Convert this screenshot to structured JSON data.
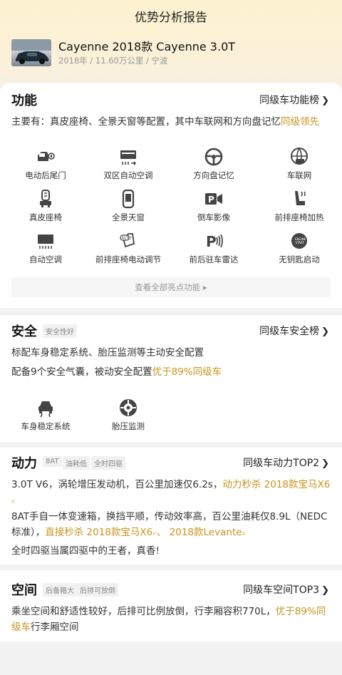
{
  "page_title": "优势分析报告",
  "car": {
    "title": "Cayenne 2018款 Cayenne 3.0T",
    "meta": "2018年 / 11.60万公里 / 宁波"
  },
  "features": {
    "title": "功能",
    "link": "同级车功能榜",
    "summary_prefix": "主要有：真皮座椅、全景天窗等配置，其中车联网和方向盘记忆",
    "summary_highlight": "同级领先",
    "items": [
      {
        "label": "电动后尾门",
        "icon": "power-tailgate-icon"
      },
      {
        "label": "双区自动空调",
        "icon": "dual-zone-ac-icon"
      },
      {
        "label": "方向盘记忆",
        "icon": "steering-wheel-icon"
      },
      {
        "label": "车联网",
        "icon": "globe-car-icon"
      },
      {
        "label": "真皮座椅",
        "icon": "leather-seat-icon"
      },
      {
        "label": "全景天窗",
        "icon": "sunroof-icon"
      },
      {
        "label": "倒车影像",
        "icon": "reverse-camera-icon"
      },
      {
        "label": "前排座椅加热",
        "icon": "seat-heating-icon"
      },
      {
        "label": "自动空调",
        "icon": "auto-ac-icon"
      },
      {
        "label": "前排座椅电动调节",
        "icon": "power-seat-icon"
      },
      {
        "label": "前后驻车雷达",
        "icon": "parking-radar-icon"
      },
      {
        "label": "无钥匙启动",
        "icon": "keyless-start-icon"
      }
    ],
    "view_all": "查看全部亮点功能 ▸"
  },
  "safety": {
    "title": "安全",
    "tag": "安全性好",
    "link": "同级车安全榜",
    "line1": "标配车身稳定系统、胎压监测等主动安全配置",
    "line2_prefix": "配备9个安全气囊，被动安全配置",
    "line2_highlight": "优于89%同级车",
    "items": [
      {
        "label": "车身稳定系统",
        "icon": "stability-icon"
      },
      {
        "label": "胎压监测",
        "icon": "tire-pressure-icon"
      }
    ]
  },
  "power": {
    "title": "动力",
    "tags": [
      "8AT",
      "油耗低",
      "全时四驱"
    ],
    "link": "同级车动力TOP2",
    "p1_prefix": "3.0T V6，涡轮增压发动机，百公里加速仅6.2s，",
    "p1_highlight": "动力秒杀  2018款宝马X6",
    "p2_prefix": "8AT手自一体变速箱，换挡平顺，传动效率高，百公里油耗仅8.9L（NEDC标准），",
    "p2_highlight_a": "直接秒杀  2018款宝马X6",
    "p2_sep": "、",
    "p2_highlight_b": "2018款Levante",
    "p3": "全时四驱当属四驱中的王者，真香!"
  },
  "space": {
    "title": "空间",
    "tags": [
      "后备箱大",
      "后排可放倒"
    ],
    "link": "同级车空间TOP3",
    "p_prefix": "乘坐空间和舒适性较好，后排可比例放倒，行李厢容积770L，",
    "p_highlight": "优于89%同级车",
    "p_suffix": "行李厢空间"
  }
}
